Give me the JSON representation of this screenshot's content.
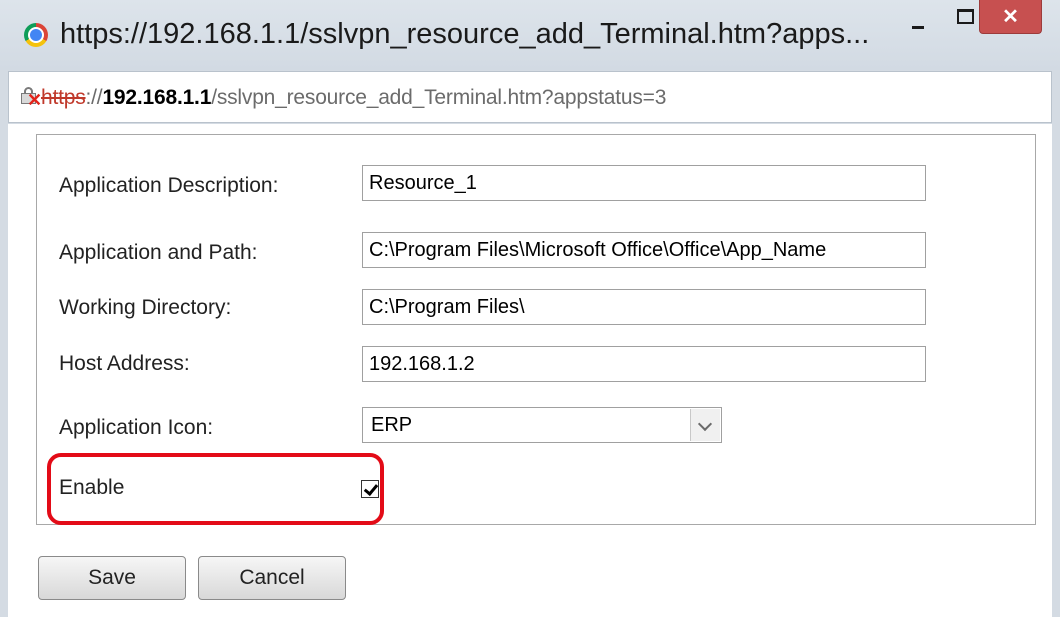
{
  "window": {
    "title": "https://192.168.1.1/sslvpn_resource_add_Terminal.htm?apps...",
    "close_glyph": "✕"
  },
  "addressbar": {
    "scheme": "https",
    "separator": "://",
    "host": "192.168.1.1",
    "path": "/sslvpn_resource_add_Terminal.htm?appstatus=3"
  },
  "form": {
    "app_description": {
      "label": "Application Description:",
      "value": "Resource_1"
    },
    "app_path": {
      "label": "Application and Path:",
      "value": "C:\\Program Files\\Microsoft Office\\Office\\App_Name"
    },
    "working_directory": {
      "label": "Working Directory:",
      "value": "C:\\Program Files\\"
    },
    "host_address": {
      "label": "Host Address:",
      "value": "192.168.1.2"
    },
    "app_icon": {
      "label": "Application Icon:",
      "selected": "ERP"
    },
    "enable": {
      "label": "Enable",
      "checked": true
    }
  },
  "buttons": {
    "save": "Save",
    "cancel": "Cancel"
  },
  "colors": {
    "highlight": "#e30b17",
    "close_button": "#c75050",
    "insecure_scheme": "#c0392b"
  }
}
